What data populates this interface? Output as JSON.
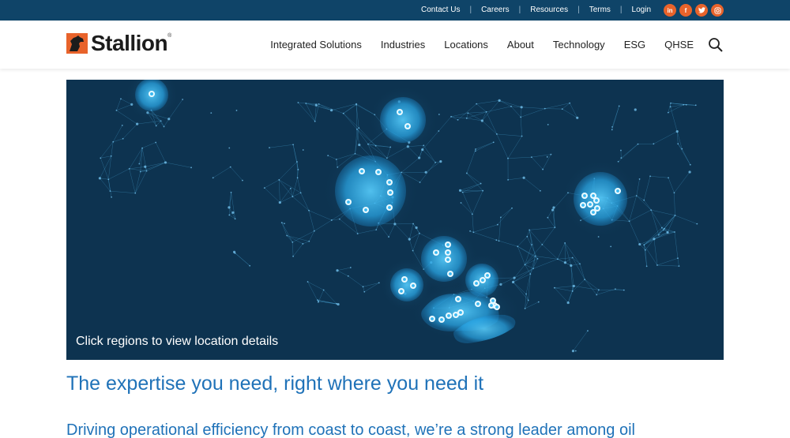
{
  "topbar": {
    "links": [
      "Contact Us",
      "Careers",
      "Resources",
      "Terms",
      "Login"
    ],
    "social": [
      {
        "icon": "linkedin-icon",
        "glyph": "in"
      },
      {
        "icon": "facebook-icon",
        "glyph": "f"
      },
      {
        "icon": "twitter-icon",
        "glyph": "t"
      },
      {
        "icon": "instagram-icon",
        "glyph": "◎"
      }
    ]
  },
  "header": {
    "logo_text": "Stallion",
    "nav": [
      "Integrated Solutions",
      "Industries",
      "Locations",
      "About",
      "Technology",
      "ESG",
      "QHSE"
    ]
  },
  "hero": {
    "caption": "Click regions to view location details"
  },
  "main": {
    "heading": "The expertise you need, right where you need it",
    "intro": "Driving operational efficiency from coast to coast, we’re a strong leader among oil"
  },
  "colors": {
    "topbar": "#0f4468",
    "accent": "#e8632b",
    "heading": "#1f72b8",
    "map_bg": "#0d3350"
  }
}
